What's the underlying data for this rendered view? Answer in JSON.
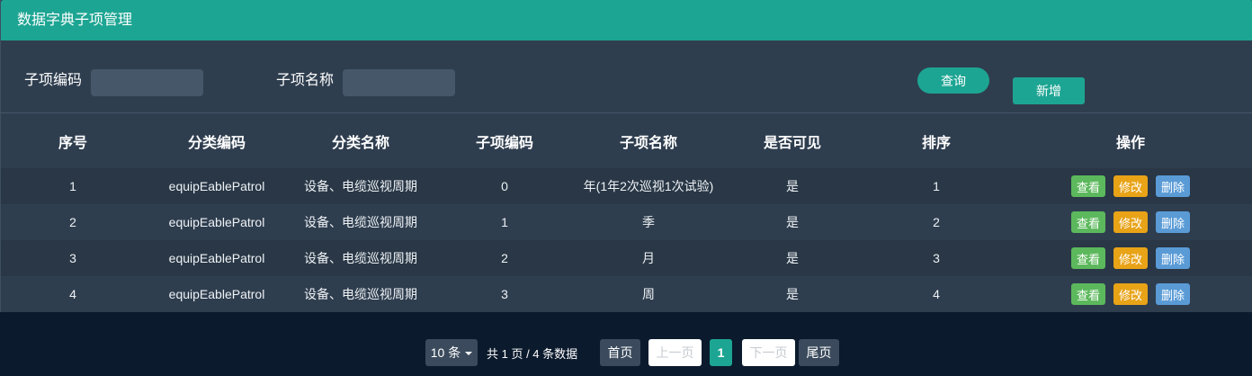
{
  "window": {
    "title": "数据字典子项管理"
  },
  "search": {
    "code_label": "子项编码",
    "code_value": "",
    "name_label": "子项名称",
    "name_value": "",
    "query_label": "查询",
    "add_label": "新增"
  },
  "table": {
    "columns": [
      "序号",
      "分类编码",
      "分类名称",
      "子项编码",
      "子项名称",
      "是否可见",
      "排序",
      "操作"
    ],
    "rows": [
      {
        "index": "1",
        "category_code": "equipEablePatrol",
        "category_name": "设备、电缆巡视周期",
        "item_code": "0",
        "item_name": "年(1年2次巡视1次试验)",
        "visible": "是",
        "sort": "1"
      },
      {
        "index": "2",
        "category_code": "equipEablePatrol",
        "category_name": "设备、电缆巡视周期",
        "item_code": "1",
        "item_name": "季",
        "visible": "是",
        "sort": "2"
      },
      {
        "index": "3",
        "category_code": "equipEablePatrol",
        "category_name": "设备、电缆巡视周期",
        "item_code": "2",
        "item_name": "月",
        "visible": "是",
        "sort": "3"
      },
      {
        "index": "4",
        "category_code": "equipEablePatrol",
        "category_name": "设备、电缆巡视周期",
        "item_code": "3",
        "item_name": "周",
        "visible": "是",
        "sort": "4"
      }
    ],
    "actions": {
      "view": "查看",
      "edit": "修改",
      "delete": "删除"
    }
  },
  "pagination": {
    "page_size": "10 条",
    "summary": "共 1 页 / 4 条数据",
    "first": "首页",
    "prev": "上一页",
    "current": "1",
    "next": "下一页",
    "last": "尾页"
  },
  "icons": {
    "page_size_caret": "caret-down-icon"
  },
  "colors": {
    "accent": "#1da593",
    "panel_bg": "#2f3e4f",
    "row_dark": "#293746",
    "row_light": "#2f3e4f",
    "input_bg": "#46576a",
    "page_bg": "#0b1a2d",
    "pager_bg": "#3b4b5d",
    "view": "#5cb85c",
    "edit": "#e8a317",
    "delete": "#5a9bd6"
  }
}
